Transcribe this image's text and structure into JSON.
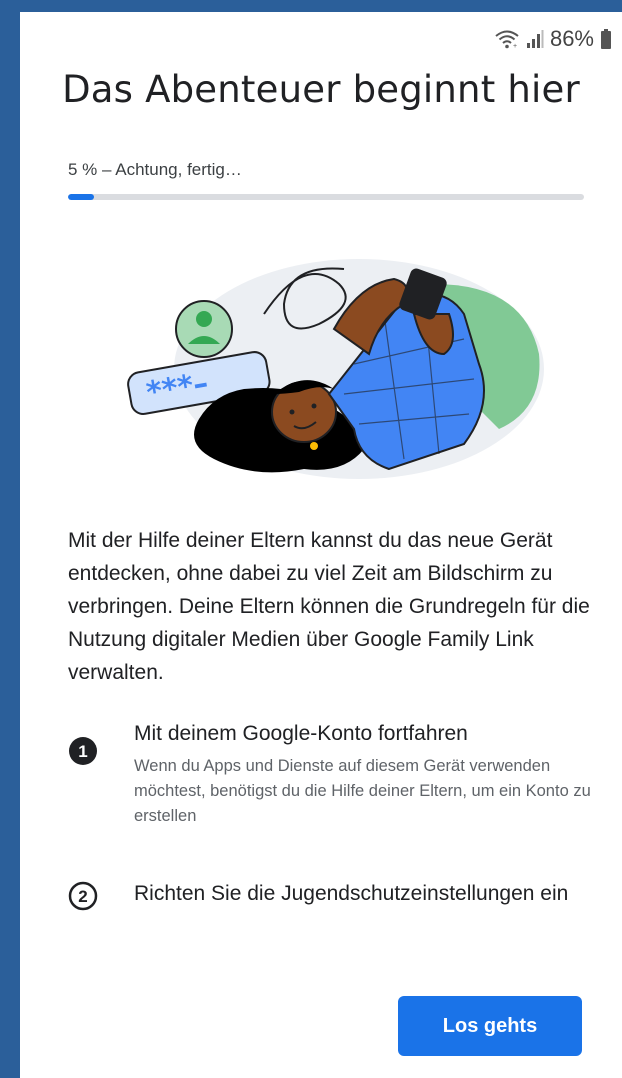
{
  "status_bar": {
    "battery_text": "86%",
    "icons": [
      "wifi-icon",
      "signal-icon",
      "battery-icon"
    ]
  },
  "header": {
    "title": "Das Abenteuer beginnt hier"
  },
  "progress": {
    "label": "5 % – Achtung, fertig…",
    "value_percent": 5,
    "color": "#1a73e8"
  },
  "illustration": {
    "password_mask": "***–"
  },
  "main": {
    "description": "Mit der Hilfe deiner Eltern kannst du das neue Gerät entdecken, ohne dabei zu viel Zeit am Bildschirm zu verbringen. Deine Eltern können die Grundregeln für die Nutzung digitaler Medien über Google Family Link verwalten."
  },
  "steps": [
    {
      "number": "1",
      "title": "Mit deinem Google-Konto fortfahren",
      "description": "Wenn du Apps und Dienste auf diesem Gerät verwenden möchtest, benötigst du die Hilfe deiner Eltern, um ein Konto zu erstellen"
    },
    {
      "number": "2",
      "title": "Richten Sie die Jugendschutzeinstellungen ein",
      "description": ""
    }
  ],
  "actions": {
    "primary_label": "Los gehts"
  },
  "colors": {
    "accent": "#1a73e8",
    "frame": "#2b5f9a"
  }
}
